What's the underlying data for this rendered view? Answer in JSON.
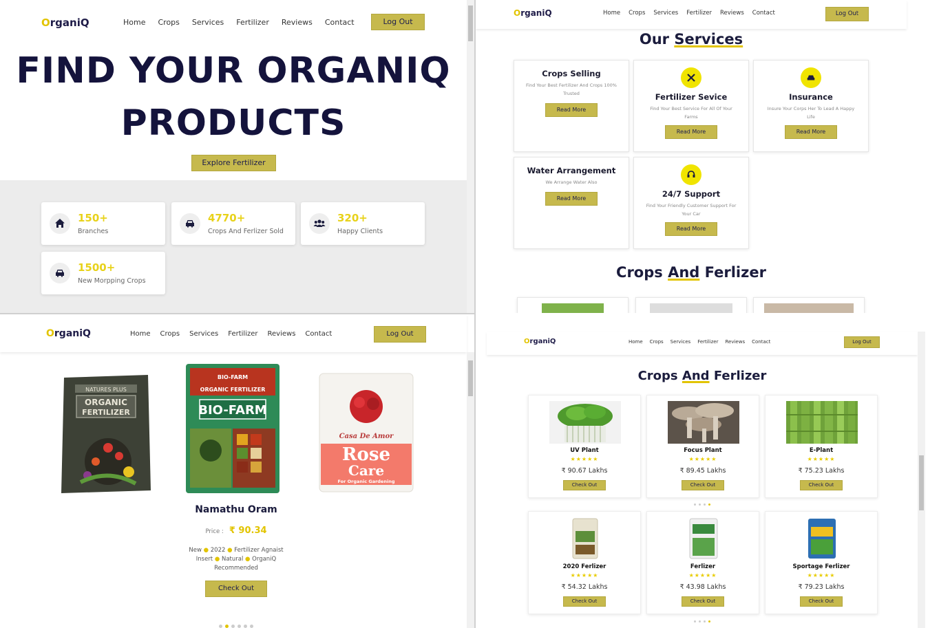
{
  "brand": {
    "logo_o": "O",
    "logo_rest": "rganiQ",
    "accent": "#e2c400",
    "olive": "#c6b94d",
    "navy": "#14133c"
  },
  "nav": {
    "items": [
      "Home",
      "Crops",
      "Services",
      "Fertilizer",
      "Reviews",
      "Contact"
    ],
    "logout": "Log Out"
  },
  "hero": {
    "line1": "FIND YOUR ORGANIQ",
    "line2": "PRODUCTS",
    "cta": "Explore Fertilizer",
    "stats": [
      {
        "value": "150+",
        "label": "Branches",
        "icon": "home-icon"
      },
      {
        "value": "4770+",
        "label": "Crops And Ferlizer Sold",
        "icon": "car-icon"
      },
      {
        "value": "320+",
        "label": "Happy Clients",
        "icon": "users-icon"
      },
      {
        "value": "1500+",
        "label": "New Morpping Crops",
        "icon": "car-icon"
      }
    ]
  },
  "services": {
    "title_a": "Our ",
    "title_b": "Services",
    "read_more": "Read More",
    "cards": [
      {
        "title": "Crops Selling",
        "desc": "Find Your Best Fertilizer And Crops 100% Trusted",
        "icon": ""
      },
      {
        "title": "Fertilizer Sevice",
        "desc": "Find Your Best Service For All Of Your Farms",
        "icon": "tools-icon"
      },
      {
        "title": "Insurance",
        "desc": "Insure Your Corps Her To Lead A Happy Life",
        "icon": "car-crash-icon"
      },
      {
        "title": "Water Arrangement",
        "desc": "We Arrange Water Also",
        "icon": ""
      },
      {
        "title": "24/7 Support",
        "desc": "Find Your Friendly Customer Support For Your Car",
        "icon": "headset-icon"
      }
    ],
    "crops_title_a": "Crops ",
    "crops_title_b": "And",
    "crops_title_c": " Ferlizer"
  },
  "featured": {
    "name": "Namathu Oram",
    "price_label": "Price :",
    "price": "₹ 90.34",
    "tags_line1": [
      "New",
      "2022",
      "Fertilizer Agnaist"
    ],
    "tags_line2": [
      "Insert",
      "Natural",
      "OrganiQ"
    ],
    "tags_line3": "Recommended",
    "cta": "Check Out",
    "images": [
      {
        "icon": "organic-fertilizer-bag",
        "top_text": "NATURES PLUS",
        "text": "ORGANIC FERTILIZER"
      },
      {
        "icon": "bio-farm-bag",
        "top_text": "BIO-FARM",
        "sub": "ORGANIC FERTILIZER",
        "text": "BIO-FARM"
      },
      {
        "icon": "rose-care-pack",
        "top_text": "Casa De Amor",
        "text": "Rose",
        "text2": "Care",
        "sub": "For Organic Gardening"
      }
    ],
    "dots_active": 1
  },
  "catalog": {
    "title_a": "Crops ",
    "title_b": "And",
    "title_c": " Ferlizer",
    "cta": "Check Out",
    "stars": "★★★★★",
    "row1": [
      {
        "name": "UV Plant",
        "price": "₹ 90.67 Lakhs",
        "icon": "microgreens-image"
      },
      {
        "name": "Focus Plant",
        "price": "₹ 89.45 Lakhs",
        "icon": "mushroom-image"
      },
      {
        "name": "E-Plant",
        "price": "₹ 75.23 Lakhs",
        "icon": "bamboo-image"
      }
    ],
    "row2": [
      {
        "name": "2020 Ferlizer",
        "price": "₹ 54.32 Lakhs",
        "icon": "fertilizer-bag-image"
      },
      {
        "name": "Ferlizer",
        "price": "₹ 43.98 Lakhs",
        "icon": "fertilizer-bag-image"
      },
      {
        "name": "Sportage Ferlizer",
        "price": "₹ 79.23 Lakhs",
        "icon": "fertilizer-bag-image"
      }
    ]
  }
}
